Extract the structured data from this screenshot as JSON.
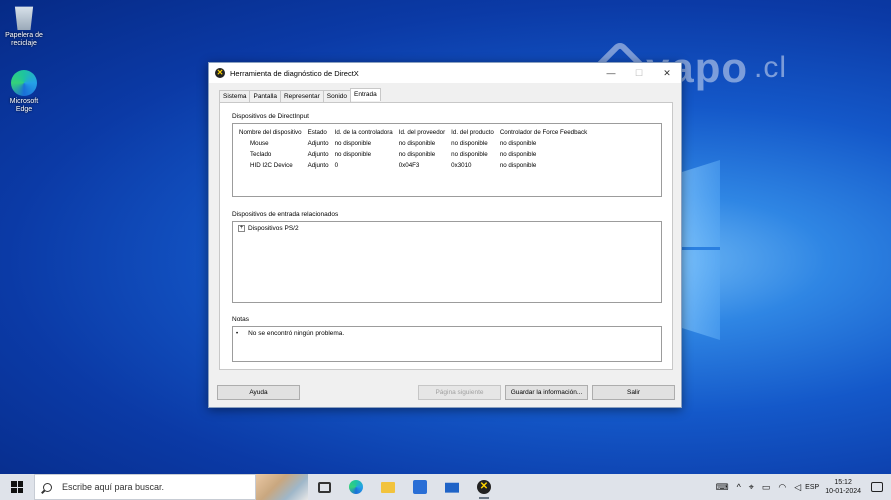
{
  "desktop": {
    "icons": [
      {
        "label": "Papelera de reciclaje",
        "icon": "recycle-bin-icon"
      },
      {
        "label": "Microsoft Edge",
        "icon": "edge-icon"
      }
    ],
    "watermark": {
      "brand": "yapo",
      "suffix": ".cl"
    }
  },
  "dialog": {
    "title": "Herramienta de diagnóstico de DirectX",
    "controls": {
      "minimize": "—",
      "maximize": "☐",
      "close": "✕"
    },
    "tabs": [
      "Sistema",
      "Pantalla",
      "Representar",
      "Sonido",
      "Entrada"
    ],
    "active_tab": "Entrada",
    "directinput": {
      "label": "Dispositivos de DirectInput",
      "columns": [
        "Nombre del dispositivo",
        "Estado",
        "Id. de la controladora",
        "Id. del proveedor",
        "Id. del producto",
        "Controlador de Force Feedback"
      ],
      "rows": [
        [
          "Mouse",
          "Adjunto",
          "no disponible",
          "no disponible",
          "no disponible",
          "no disponible"
        ],
        [
          "Teclado",
          "Adjunto",
          "no disponible",
          "no disponible",
          "no disponible",
          "no disponible"
        ],
        [
          "HID I2C Device",
          "Adjunto",
          "0",
          "0x04F3",
          "0x3010",
          "no disponible"
        ]
      ]
    },
    "related": {
      "label": "Dispositivos de entrada relacionados",
      "tree_expand": "+",
      "tree_item": "Dispositivos PS/2"
    },
    "notes": {
      "label": "Notas",
      "bullet": "•",
      "text": "No se encontró ningún problema."
    },
    "buttons": {
      "help": "Ayuda",
      "next_page": "Página siguiente",
      "save_info": "Guardar la información...",
      "exit": "Salir"
    }
  },
  "taskbar": {
    "search_placeholder": "Escribe aquí para buscar.",
    "apps": [
      "task-view-icon",
      "edge-icon",
      "file-explorer-icon",
      "store-icon",
      "mail-icon",
      "directx-icon"
    ],
    "tray": {
      "chevron": "^",
      "language": "ESP",
      "time": "15:12",
      "date": "10-01-2024"
    }
  }
}
